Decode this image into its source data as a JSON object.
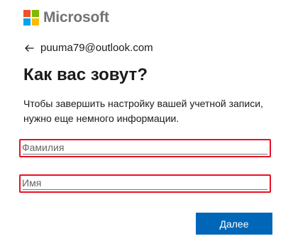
{
  "brand": {
    "name": "Microsoft",
    "logo_colors": [
      "#f25022",
      "#7fba00",
      "#00a4ef",
      "#ffb900"
    ],
    "text_color": "#737373"
  },
  "identity": {
    "back_icon": "arrow-left-icon",
    "email": "puuma79@outlook.com"
  },
  "form": {
    "title": "Как вас зовут?",
    "description": "Чтобы завершить настройку вашей учетной записи, нужно еще немного информации.",
    "last_name": {
      "placeholder": "Фамилия",
      "value": ""
    },
    "first_name": {
      "placeholder": "Имя",
      "value": ""
    },
    "next_label": "Далее"
  },
  "colors": {
    "accent": "#0067b8",
    "error_border": "#e81123"
  }
}
